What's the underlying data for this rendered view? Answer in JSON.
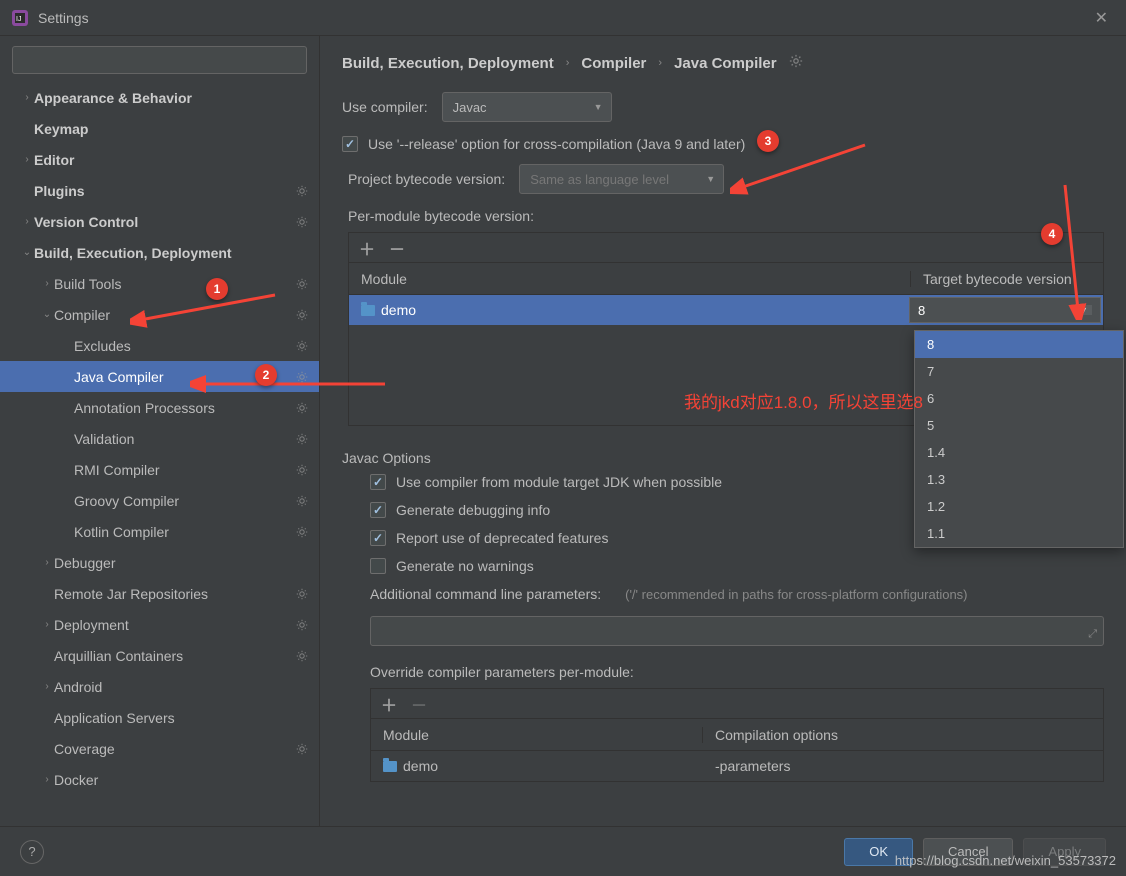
{
  "window": {
    "title": "Settings"
  },
  "search": {
    "placeholder": ""
  },
  "tree": {
    "items": [
      {
        "label": "Appearance & Behavior",
        "chev": "›",
        "ind": 0,
        "bold": true
      },
      {
        "label": "Keymap",
        "chev": "",
        "ind": 0,
        "bold": true
      },
      {
        "label": "Editor",
        "chev": "›",
        "ind": 0,
        "bold": true
      },
      {
        "label": "Plugins",
        "chev": "",
        "ind": 0,
        "bold": true,
        "gear": true
      },
      {
        "label": "Version Control",
        "chev": "›",
        "ind": 0,
        "bold": true,
        "gear": true
      },
      {
        "label": "Build, Execution, Deployment",
        "chev": "⌄",
        "ind": 0,
        "bold": true
      },
      {
        "label": "Build Tools",
        "chev": "›",
        "ind": 1,
        "gear": true
      },
      {
        "label": "Compiler",
        "chev": "⌄",
        "ind": 1,
        "gear": true
      },
      {
        "label": "Excludes",
        "chev": "",
        "ind": 2,
        "gear": true
      },
      {
        "label": "Java Compiler",
        "chev": "",
        "ind": 2,
        "gear": true,
        "selected": true
      },
      {
        "label": "Annotation Processors",
        "chev": "",
        "ind": 2,
        "gear": true
      },
      {
        "label": "Validation",
        "chev": "",
        "ind": 2,
        "gear": true
      },
      {
        "label": "RMI Compiler",
        "chev": "",
        "ind": 2,
        "gear": true
      },
      {
        "label": "Groovy Compiler",
        "chev": "",
        "ind": 2,
        "gear": true
      },
      {
        "label": "Kotlin Compiler",
        "chev": "",
        "ind": 2,
        "gear": true
      },
      {
        "label": "Debugger",
        "chev": "›",
        "ind": 1
      },
      {
        "label": "Remote Jar Repositories",
        "chev": "",
        "ind": 1,
        "gear": true
      },
      {
        "label": "Deployment",
        "chev": "›",
        "ind": 1,
        "gear": true
      },
      {
        "label": "Arquillian Containers",
        "chev": "",
        "ind": 1,
        "gear": true
      },
      {
        "label": "Android",
        "chev": "›",
        "ind": 1
      },
      {
        "label": "Application Servers",
        "chev": "",
        "ind": 1
      },
      {
        "label": "Coverage",
        "chev": "",
        "ind": 1,
        "gear": true
      },
      {
        "label": "Docker",
        "chev": "›",
        "ind": 1
      }
    ]
  },
  "breadcrumb": {
    "part1": "Build, Execution, Deployment",
    "part2": "Compiler",
    "part3": "Java Compiler"
  },
  "compiler": {
    "use_compiler_label": "Use compiler:",
    "compiler_value": "Javac",
    "release_option": "Use '--release' option for cross-compilation (Java 9 and later)",
    "project_bytecode_label": "Project bytecode version:",
    "project_bytecode_placeholder": "Same as language level",
    "per_module_label": "Per-module bytecode version:",
    "table": {
      "col1": "Module",
      "col2": "Target bytecode version",
      "module_name": "demo",
      "target_value": "8"
    },
    "dropdown_options": [
      "8",
      "7",
      "6",
      "5",
      "1.4",
      "1.3",
      "1.2",
      "1.1"
    ]
  },
  "javac": {
    "section": "Javac Options",
    "opt1": "Use compiler from module target JDK when possible",
    "opt2": "Generate debugging info",
    "opt3": "Report use of deprecated features",
    "opt4": "Generate no warnings",
    "additional_label": "Additional command line parameters:",
    "additional_hint": "('/' recommended in paths for cross-platform configurations)",
    "override_label": "Override compiler parameters per-module:",
    "table2": {
      "col1": "Module",
      "col2": "Compilation options",
      "module": "demo",
      "options": "-parameters"
    }
  },
  "footer": {
    "ok": "OK",
    "cancel": "Cancel",
    "apply": "Apply"
  },
  "annotations": {
    "badge1": "1",
    "badge2": "2",
    "badge3": "3",
    "badge4": "4",
    "text": "我的jkd对应1.8.0，所以这里选8",
    "watermark": "https://blog.csdn.net/weixin_53573372"
  }
}
